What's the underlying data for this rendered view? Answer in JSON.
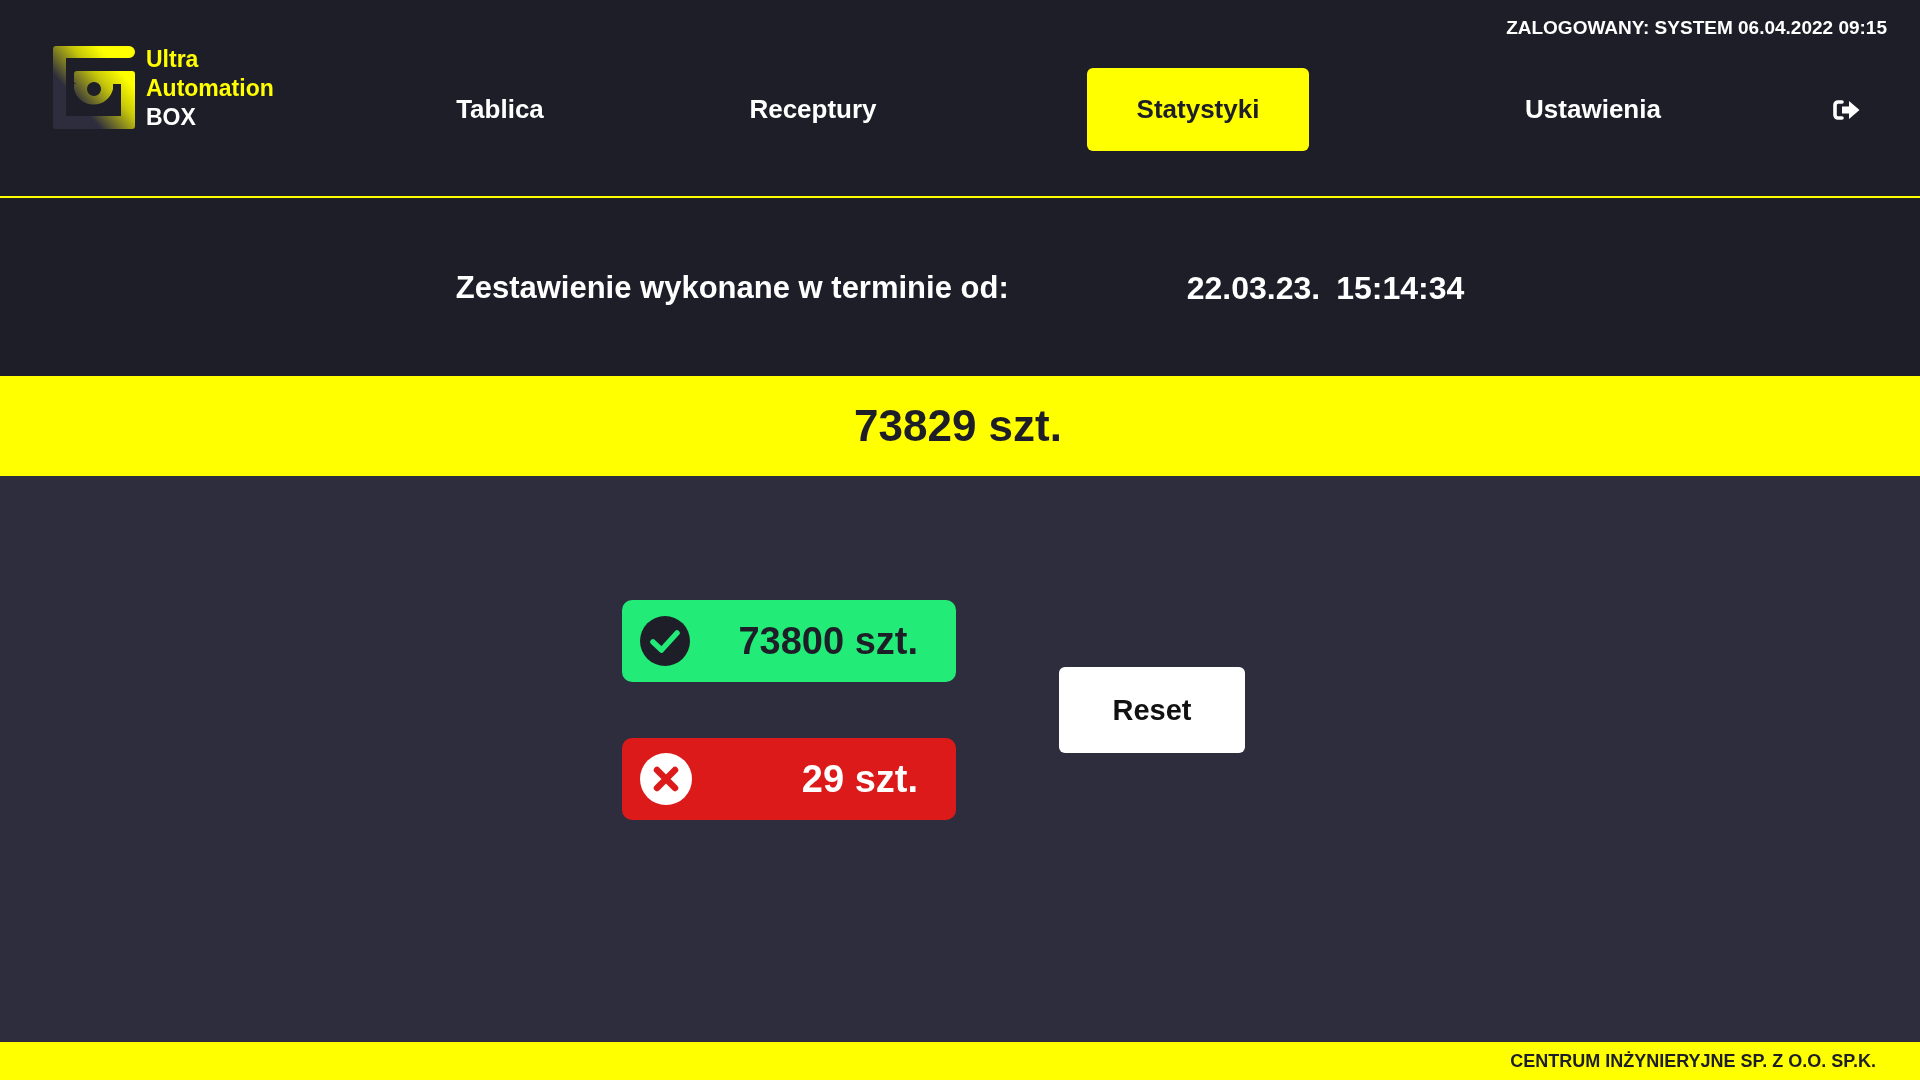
{
  "header": {
    "logo_lines": [
      "Ultra",
      "Automation"
    ],
    "logo_suffix": "BOX",
    "status": "ZALOGOWANY: SYSTEM 06.04.2022 09:15"
  },
  "tabs": [
    {
      "label": "Tablica",
      "selected": false
    },
    {
      "label": "Receptury",
      "selected": false
    },
    {
      "label": "Statystyki",
      "selected": true
    },
    {
      "label": "Ustawienia",
      "selected": false
    }
  ],
  "summary": {
    "label": "Zestawienie wykonane w terminie od:",
    "date": "22.03.23.",
    "time": "15:14:34"
  },
  "total": "73829 szt.",
  "counters": [
    {
      "kind": "accepted",
      "value": "73800 szt."
    },
    {
      "kind": "rejected",
      "value": "29 szt."
    }
  ],
  "reset_button": "Reset",
  "footer": "CENTRUM INŻYNIERYJNE SP. Z O.O. SP.K."
}
